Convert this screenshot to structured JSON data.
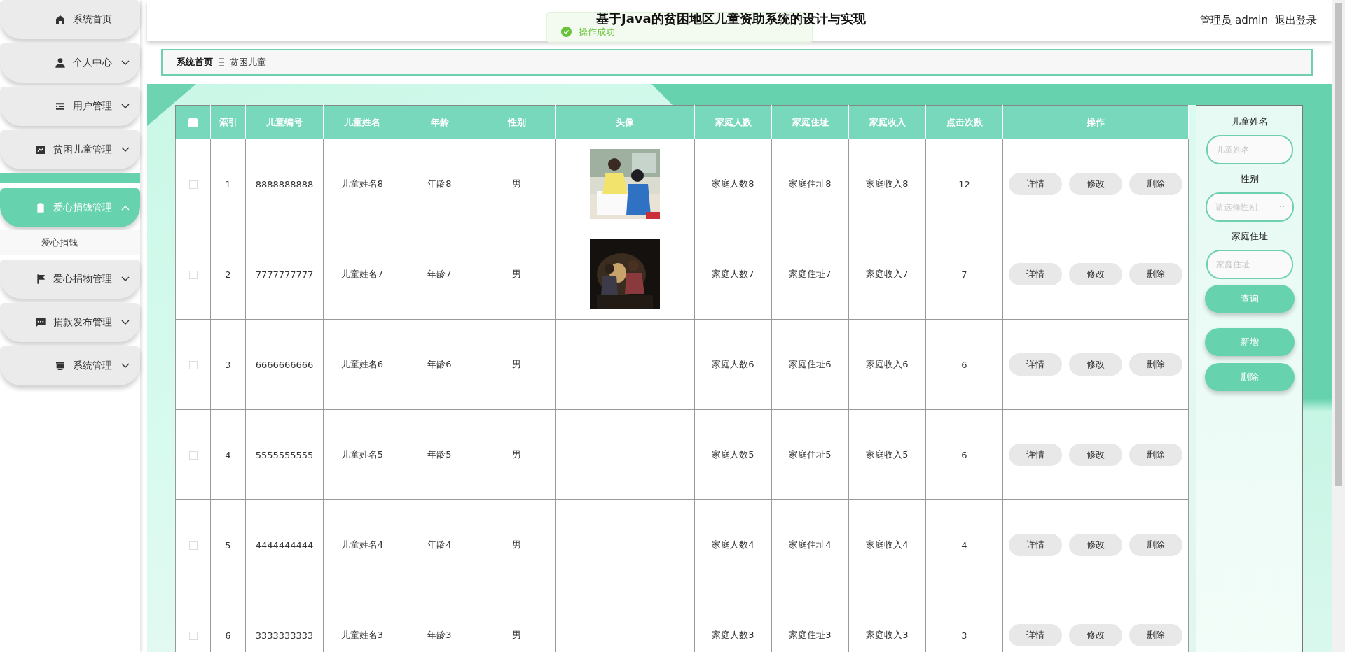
{
  "sidebar": {
    "items": [
      {
        "label": "系统首页",
        "kind": "link",
        "selected": false
      },
      {
        "label": "个人中心",
        "kind": "menu",
        "selected": false,
        "expanded": false
      },
      {
        "label": "用户管理",
        "kind": "menu",
        "selected": false,
        "expanded": false
      },
      {
        "label": "贫困儿童管理",
        "kind": "menu",
        "selected": false,
        "expanded": false
      },
      {
        "label": "爱心捐钱管理",
        "kind": "menu",
        "selected": true,
        "expanded": true,
        "children": [
          {
            "label": "爱心捐钱"
          }
        ]
      },
      {
        "label": "爱心捐物管理",
        "kind": "menu",
        "selected": false,
        "expanded": false
      },
      {
        "label": "捐款发布管理",
        "kind": "menu",
        "selected": false,
        "expanded": false
      },
      {
        "label": "系统管理",
        "kind": "menu",
        "selected": false,
        "expanded": false
      }
    ]
  },
  "header": {
    "title": "基于Java的贫困地区儿童资助系统的设计与实现",
    "user": "管理员 admin",
    "logout": "退出登录"
  },
  "toast": {
    "message": "操作成功"
  },
  "breadcrumb": [
    {
      "label": "系统首页"
    },
    {
      "label": "贫困儿童"
    }
  ],
  "table": {
    "select_all": {
      "checked": false
    },
    "columns": [
      "索引",
      "儿童编号",
      "儿童姓名",
      "年龄",
      "性别",
      "头像",
      "家庭人数",
      "家庭住址",
      "家庭收入",
      "点击次数",
      "操作"
    ],
    "rows": [
      {
        "checked": false,
        "index": "1",
        "number": "8888888888",
        "name": "儿童姓名8",
        "age": "年龄8",
        "gender": "男",
        "family_size": "家庭人数8",
        "address": "家庭住址8",
        "income": "家庭收入8",
        "clicks": "12",
        "actions": [
          "详情",
          "修改",
          "删除"
        ]
      },
      {
        "checked": false,
        "index": "2",
        "number": "7777777777",
        "name": "儿童姓名7",
        "age": "年龄7",
        "gender": "男",
        "family_size": "家庭人数7",
        "address": "家庭住址7",
        "income": "家庭收入7",
        "clicks": "7",
        "actions": [
          "详情",
          "修改",
          "删除"
        ]
      },
      {
        "checked": false,
        "index": "3",
        "number": "6666666666",
        "name": "儿童姓名6",
        "age": "年龄6",
        "gender": "男",
        "family_size": "家庭人数6",
        "address": "家庭住址6",
        "income": "家庭收入6",
        "clicks": "6",
        "actions": [
          "详情",
          "修改",
          "删除"
        ]
      },
      {
        "checked": false,
        "index": "4",
        "number": "5555555555",
        "name": "儿童姓名5",
        "age": "年龄5",
        "gender": "男",
        "family_size": "家庭人数5",
        "address": "家庭住址5",
        "income": "家庭收入5",
        "clicks": "6",
        "actions": [
          "详情",
          "修改",
          "删除"
        ]
      },
      {
        "checked": false,
        "index": "5",
        "number": "4444444444",
        "name": "儿童姓名4",
        "age": "年龄4",
        "gender": "男",
        "family_size": "家庭人数4",
        "address": "家庭住址4",
        "income": "家庭收入4",
        "clicks": "4",
        "actions": [
          "详情",
          "修改",
          "删除"
        ]
      },
      {
        "checked": false,
        "index": "6",
        "number": "3333333333",
        "name": "儿童姓名3",
        "age": "年龄3",
        "gender": "男",
        "family_size": "家庭人数3",
        "address": "家庭住址3",
        "income": "家庭收入3",
        "clicks": "3",
        "actions": [
          "详情",
          "修改",
          "删除"
        ]
      }
    ]
  },
  "search": {
    "fields": [
      {
        "label": "儿童姓名",
        "kind": "input",
        "placeholder": "儿童姓名"
      },
      {
        "label": "性别",
        "kind": "select",
        "placeholder": "请选择性别"
      },
      {
        "label": "家庭住址",
        "kind": "input",
        "placeholder": "家庭住址"
      }
    ],
    "buttons": [
      "查询",
      "新增",
      "删除"
    ]
  }
}
